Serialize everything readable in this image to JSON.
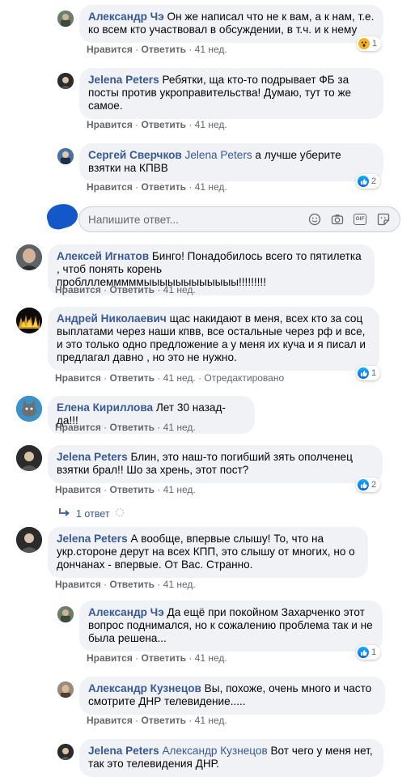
{
  "comments": [
    {
      "author": "Александр Чэ",
      "text": "Он же написал что не к вам, а к нам, т.е. ко всем кто участвовал в обсуждении, в т.ч. и к нему",
      "like": "Нравится",
      "reply": "Ответить",
      "time": "41 нед.",
      "reaction_count": "1"
    },
    {
      "author": "Jelena Peters",
      "text": "Ребятки, ща кто-то подрывает ФБ за посты против укроправительства! Думаю, тут то же самое.",
      "like": "Нравится",
      "reply": "Ответить",
      "time": "41 нед."
    },
    {
      "author": "Сергей Сверчков",
      "mention": "Jelena Peters",
      "text": "а лучше уберите взятки на КПВВ",
      "like": "Нравится",
      "reply": "Ответить",
      "time": "41 нед.",
      "reaction_count": "2"
    },
    {
      "author": "Алексей Игнатов",
      "text": "Бинго! Понадобилось всего то пятилетка , чтоб понять корень проблллемммммыыыыыыыыыыыы!!!!!!!!!",
      "like": "Нравится",
      "reply": "Ответить",
      "time": "41 нед."
    },
    {
      "author": "Андрей Николаевич",
      "text": "щас накидают в меня, всех кто за соц выплатами через наши кпвв, все остальные через рф и все, и это только одно предложение а у меня их куча и я писал и предлагал давно , но это не нужно.",
      "like": "Нравится",
      "reply": "Ответить",
      "time": "41 нед.",
      "edited": "Отредактировано",
      "reaction_count": "1"
    },
    {
      "author": "Елена Кириллова",
      "text": "Лет 30 назад- да!!!",
      "like": "Нравится",
      "reply": "Ответить",
      "time": "41 нед."
    },
    {
      "author": "Jelena Peters",
      "text": "Блин, это наш-то погибший зять ополченец взятки брал!! Шо за хрень, этот пост?",
      "like": "Нравится",
      "reply": "Ответить",
      "time": "41 нед.",
      "reaction_count": "2"
    },
    {
      "author": "Jelena Peters",
      "text": "А вообще, впервые слышу! То, что на укр.стороне дерут на всех КПП, это слышу от многих, но о дончанах - впервые. От Вас. Странно.",
      "like": "Нравится",
      "reply": "Ответить",
      "time": "41 нед."
    },
    {
      "author": "Александр Чэ",
      "text": "Да ещё при покойном Захарченко этот вопрос поднимался, но к сожалению проблема так и не была решена...",
      "like": "Нравится",
      "reply": "Ответить",
      "time": "41 нед.",
      "reaction_count": "1"
    },
    {
      "author": "Александр Кузнецов",
      "text": "Вы, похоже, очень много и часто смотрите ДНР телевидение.....",
      "like": "Нравится",
      "reply": "Ответить",
      "time": "41 нед."
    },
    {
      "author": "Jelena Peters",
      "mention": "Александр Кузнецов",
      "text": "Вот чего у меня нет, так это телевидения ДНР."
    }
  ],
  "reply_box": {
    "placeholder": "Напишите ответ...",
    "icons": [
      "emoji-icon",
      "camera-icon",
      "gif-icon",
      "sticker-icon"
    ]
  },
  "view_replies": {
    "label": "1 ответ"
  },
  "ui": {
    "dot": "·",
    "gif_text": "GIF"
  },
  "colors": {
    "name": "#385898",
    "bubble": "#f0f2f5",
    "meta": "#65676b",
    "like": "#1877f2",
    "thread": "#ced0d4"
  }
}
